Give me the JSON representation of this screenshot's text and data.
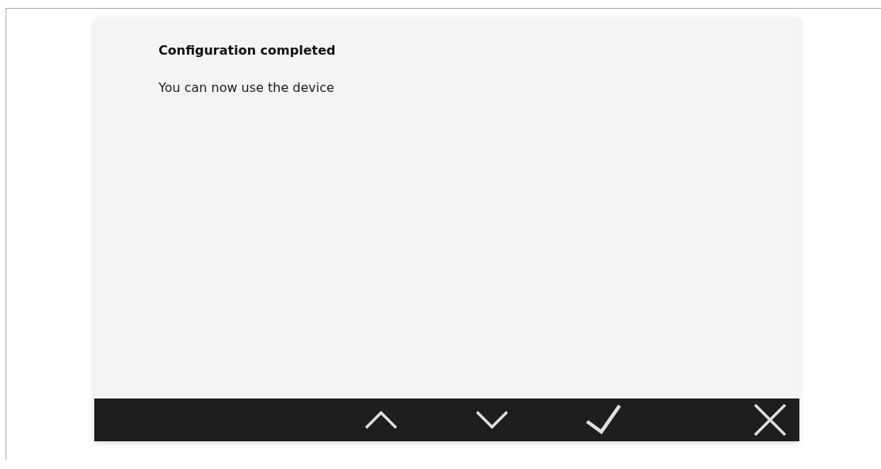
{
  "dialog": {
    "title": "Configuration completed",
    "message": "You can now use the device"
  },
  "toolbar": {
    "buttons": [
      {
        "kind": "up"
      },
      {
        "kind": "down"
      },
      {
        "kind": "confirm"
      },
      {
        "kind": "close"
      }
    ]
  }
}
